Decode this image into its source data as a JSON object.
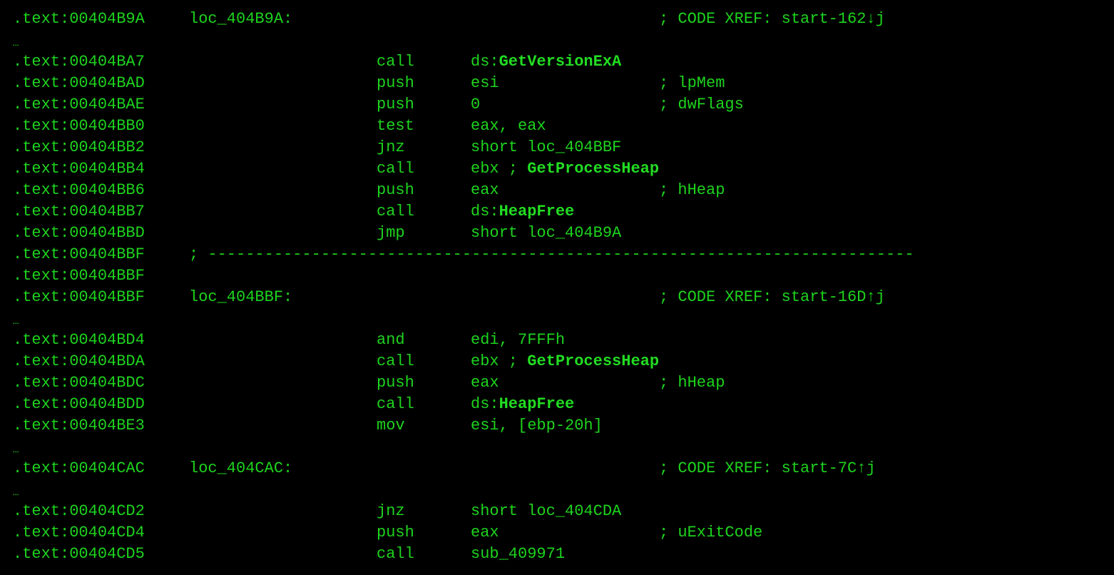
{
  "theme": {
    "background": "#000000",
    "text_color": "#1ed31e",
    "highlight_color": "#22dd22"
  },
  "lines": [
    {
      "type": "label",
      "addr": ".text:00404B9A",
      "label": "loc_404B9A:",
      "comment": "; CODE XREF: start-162↓j"
    },
    {
      "type": "ellipsis",
      "text": "…"
    },
    {
      "type": "insn",
      "addr": ".text:00404BA7",
      "mnemonic": "call",
      "op_prefix": "ds:",
      "op_bold": "GetVersionExA",
      "comment": ""
    },
    {
      "type": "insn",
      "addr": ".text:00404BAD",
      "mnemonic": "push",
      "op_prefix": "esi",
      "op_bold": "",
      "comment": "; lpMem"
    },
    {
      "type": "insn",
      "addr": ".text:00404BAE",
      "mnemonic": "push",
      "op_prefix": "0",
      "op_bold": "",
      "comment": "; dwFlags"
    },
    {
      "type": "insn",
      "addr": ".text:00404BB0",
      "mnemonic": "test",
      "op_prefix": "eax, eax",
      "op_bold": "",
      "comment": ""
    },
    {
      "type": "insn",
      "addr": ".text:00404BB2",
      "mnemonic": "jnz",
      "op_prefix": "short loc_404BBF",
      "op_bold": "",
      "comment": ""
    },
    {
      "type": "insn",
      "addr": ".text:00404BB4",
      "mnemonic": "call",
      "op_prefix": "ebx ; ",
      "op_bold": "GetProcessHeap",
      "comment": ""
    },
    {
      "type": "insn",
      "addr": ".text:00404BB6",
      "mnemonic": "push",
      "op_prefix": "eax",
      "op_bold": "",
      "comment": "; hHeap"
    },
    {
      "type": "insn",
      "addr": ".text:00404BB7",
      "mnemonic": "call",
      "op_prefix": "ds:",
      "op_bold": "HeapFree",
      "comment": ""
    },
    {
      "type": "insn",
      "addr": ".text:00404BBD",
      "mnemonic": "jmp",
      "op_prefix": "short loc_404B9A",
      "op_bold": "",
      "comment": ""
    },
    {
      "type": "separator",
      "addr": ".text:00404BBF",
      "text": "; ---------------------------------------------------------------------------"
    },
    {
      "type": "addr_only",
      "addr": ".text:00404BBF"
    },
    {
      "type": "label",
      "addr": ".text:00404BBF",
      "label": "loc_404BBF:",
      "comment": "; CODE XREF: start-16D↑j"
    },
    {
      "type": "ellipsis",
      "text": "…"
    },
    {
      "type": "insn",
      "addr": ".text:00404BD4",
      "mnemonic": "and",
      "op_prefix": "edi, 7FFFh",
      "op_bold": "",
      "comment": ""
    },
    {
      "type": "insn",
      "addr": ".text:00404BDA",
      "mnemonic": "call",
      "op_prefix": "ebx ; ",
      "op_bold": "GetProcessHeap",
      "comment": ""
    },
    {
      "type": "insn",
      "addr": ".text:00404BDC",
      "mnemonic": "push",
      "op_prefix": "eax",
      "op_bold": "",
      "comment": "; hHeap"
    },
    {
      "type": "insn",
      "addr": ".text:00404BDD",
      "mnemonic": "call",
      "op_prefix": "ds:",
      "op_bold": "HeapFree",
      "comment": ""
    },
    {
      "type": "insn",
      "addr": ".text:00404BE3",
      "mnemonic": "mov",
      "op_prefix": "esi, [ebp-20h]",
      "op_bold": "",
      "comment": ""
    },
    {
      "type": "ellipsis",
      "text": "…"
    },
    {
      "type": "label",
      "addr": ".text:00404CAC",
      "label": "loc_404CAC:",
      "comment": "; CODE XREF: start-7C↑j"
    },
    {
      "type": "ellipsis",
      "text": "…"
    },
    {
      "type": "insn",
      "addr": ".text:00404CD2",
      "mnemonic": "jnz",
      "op_prefix": "short loc_404CDA",
      "op_bold": "",
      "comment": ""
    },
    {
      "type": "insn",
      "addr": ".text:00404CD4",
      "mnemonic": "push",
      "op_prefix": "eax",
      "op_bold": "",
      "comment": "; uExitCode"
    },
    {
      "type": "insn",
      "addr": ".text:00404CD5",
      "mnemonic": "call",
      "op_prefix": "sub_409971",
      "op_bold": "",
      "comment": ""
    }
  ]
}
